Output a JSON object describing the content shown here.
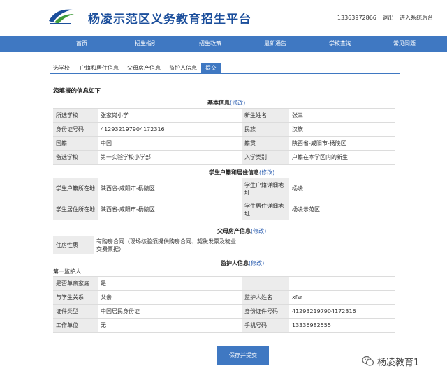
{
  "header": {
    "site_title": "杨凌示范区义务教育招生平台",
    "phone": "13363972866",
    "logout": "退出",
    "backend": "进入系统后台"
  },
  "nav": {
    "items": [
      "首页",
      "招生指引",
      "招生政策",
      "最新通告",
      "学校查询",
      "常见问题"
    ]
  },
  "tabs": {
    "items": [
      "选学校",
      "户籍和居住信息",
      "父母房产信息",
      "监护人信息",
      "提交"
    ],
    "active": "提交"
  },
  "summary_title": "您填报的信息如下",
  "edit_label": "(修改)",
  "basic": {
    "title": "基本信息",
    "rows": [
      [
        "所选学校",
        "张家岗小学",
        "新生姓名",
        "张三"
      ],
      [
        "身份证号码",
        "412932197904172316",
        "民族",
        "汉族"
      ],
      [
        "国籍",
        "中国",
        "籍贯",
        "陕西省-咸阳市-杨陵区"
      ],
      [
        "备选学校",
        "第一实验学校小学部",
        "入学类别",
        "户籍在本学区内的新生"
      ]
    ]
  },
  "residence": {
    "title": "学生户籍和居住信息",
    "rows": [
      [
        "学生户籍所在地",
        "陕西省-咸阳市-杨陵区",
        "学生户籍详细地址",
        "杨凌"
      ],
      [
        "学生居住所在地",
        "陕西省-咸阳市-杨陵区",
        "学生居住详细地址",
        "杨凌示范区"
      ]
    ]
  },
  "property": {
    "title": "父母房产信息",
    "label": "住房性质",
    "value": "有购房合同（现场核验须提供购房合同、契税发票及物业交费票据）"
  },
  "guardian": {
    "title": "监护人信息",
    "sub_label": "第一监护人",
    "rows": [
      [
        "是否单亲家庭",
        "是",
        "",
        ""
      ],
      [
        "与学生关系",
        "父亲",
        "监护人姓名",
        "xfsr"
      ],
      [
        "证件类型",
        "中国居民身份证",
        "身份证件号码",
        "412932197904172316"
      ],
      [
        "工作单位",
        "无",
        "手机号码",
        "13336982555"
      ]
    ]
  },
  "save_button": "保存并提交",
  "watermark": "杨凌教育1",
  "colors": {
    "brand_blue": "#3f78c2",
    "title_blue": "#1c4f9c",
    "label_bg": "#ececec"
  }
}
